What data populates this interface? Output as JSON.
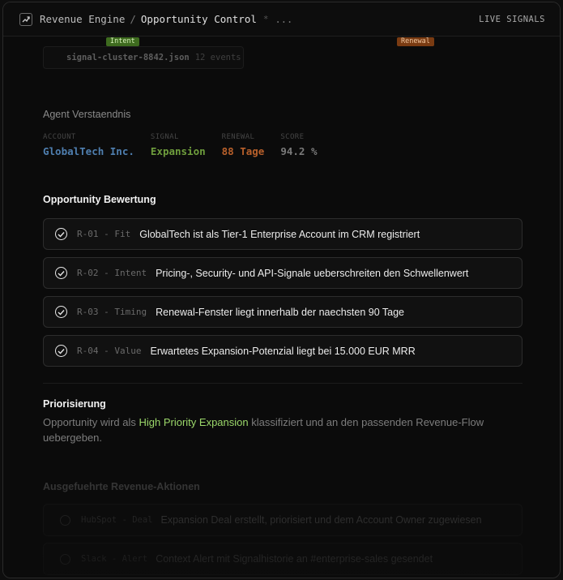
{
  "header": {
    "breadcrumb_root": "Revenue Engine",
    "separator": "/",
    "breadcrumb_current": "Opportunity Control",
    "status_dot": "*",
    "more": "...",
    "live_label": "LIVE SIGNALS"
  },
  "tags": {
    "intent": "Intent",
    "renewal": "Renewal"
  },
  "file_chip": {
    "name": "signal-cluster-8842.json",
    "count": "12 events"
  },
  "understanding": {
    "title": "Agent Verstaendnis",
    "fields": [
      {
        "label": "ACCOUNT",
        "value": "GlobalTech Inc.",
        "color": "#4f7fb0"
      },
      {
        "label": "SIGNAL",
        "value": "Expansion",
        "color": "#6f9e3d"
      },
      {
        "label": "RENEWAL",
        "value": "88 Tage",
        "color": "#b8602b"
      },
      {
        "label": "SCORE",
        "value": "94.2 %",
        "color": "#7a7a7a"
      }
    ]
  },
  "evaluation": {
    "title": "Opportunity Bewertung",
    "rules": [
      {
        "id": "R-01 - Fit",
        "text": "GlobalTech ist als Tier-1 Enterprise Account im CRM registriert"
      },
      {
        "id": "R-02 - Intent",
        "text": "Pricing-, Security- und API-Signale ueberschreiten den Schwellenwert"
      },
      {
        "id": "R-03 - Timing",
        "text": "Renewal-Fenster liegt innerhalb der naechsten 90 Tage"
      },
      {
        "id": "R-04 - Value",
        "text": "Erwartetes Expansion-Potenzial liegt bei 15.000 EUR MRR"
      }
    ]
  },
  "priority": {
    "title": "Priorisierung",
    "text_before": "Opportunity wird als ",
    "highlight": "High Priority Expansion",
    "text_after": " klassifiziert und an den passenden Revenue-Flow uebergeben."
  },
  "actions": {
    "title": "Ausgefuehrte Revenue-Aktionen",
    "items": [
      {
        "id": "HubSpot - Deal",
        "text": "Expansion Deal erstellt, priorisiert und dem Account Owner zugewiesen"
      },
      {
        "id": "Slack - Alert",
        "text": "Context Alert mit Signalhistorie an #enterprise-sales gesendet"
      }
    ]
  },
  "colors": {
    "accent_green": "#9bd76a",
    "tag_intent_bg": "#3e6b1f",
    "tag_renewal_bg": "#7a3b12"
  }
}
